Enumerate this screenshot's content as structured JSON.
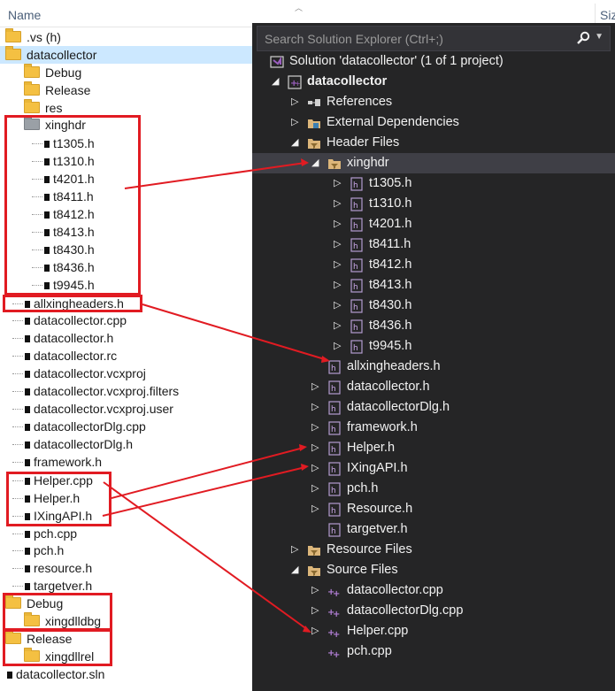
{
  "left_panel": {
    "header": {
      "name": "Name",
      "size": "Siz"
    },
    "rows": [
      {
        "label": ".vs (h)",
        "kind": "folder"
      },
      {
        "label": "datacollector",
        "kind": "folder"
      },
      {
        "label": "Debug",
        "kind": "folder"
      },
      {
        "label": "Release",
        "kind": "folder"
      },
      {
        "label": "res",
        "kind": "folder"
      },
      {
        "label": "xinghdr",
        "kind": "folder"
      },
      {
        "label": "t1305.h",
        "kind": "file"
      },
      {
        "label": "t1310.h",
        "kind": "file"
      },
      {
        "label": "t4201.h",
        "kind": "file"
      },
      {
        "label": "t8411.h",
        "kind": "file"
      },
      {
        "label": "t8412.h",
        "kind": "file"
      },
      {
        "label": "t8413.h",
        "kind": "file"
      },
      {
        "label": "t8430.h",
        "kind": "file"
      },
      {
        "label": "t8436.h",
        "kind": "file"
      },
      {
        "label": "t9945.h",
        "kind": "file"
      },
      {
        "label": "allxingheaders.h",
        "kind": "file"
      },
      {
        "label": "datacollector.cpp",
        "kind": "file"
      },
      {
        "label": "datacollector.h",
        "kind": "file"
      },
      {
        "label": "datacollector.rc",
        "kind": "file"
      },
      {
        "label": "datacollector.vcxproj",
        "kind": "file"
      },
      {
        "label": "datacollector.vcxproj.filters",
        "kind": "file"
      },
      {
        "label": "datacollector.vcxproj.user",
        "kind": "file"
      },
      {
        "label": "datacollectorDlg.cpp",
        "kind": "file"
      },
      {
        "label": "datacollectorDlg.h",
        "kind": "file"
      },
      {
        "label": "framework.h",
        "kind": "file"
      },
      {
        "label": "Helper.cpp",
        "kind": "file"
      },
      {
        "label": "Helper.h",
        "kind": "file"
      },
      {
        "label": "IXingAPI.h",
        "kind": "file"
      },
      {
        "label": "pch.cpp",
        "kind": "file"
      },
      {
        "label": "pch.h",
        "kind": "file"
      },
      {
        "label": "resource.h",
        "kind": "file"
      },
      {
        "label": "targetver.h",
        "kind": "file"
      },
      {
        "label": "Debug",
        "kind": "folder"
      },
      {
        "label": "xingdlldbg",
        "kind": "folder"
      },
      {
        "label": "Release",
        "kind": "folder"
      },
      {
        "label": "xingdllrel",
        "kind": "folder"
      },
      {
        "label": "datacollector.sln",
        "kind": "file"
      }
    ]
  },
  "solution_explorer": {
    "search_placeholder": "Search Solution Explorer (Ctrl+;)",
    "rows": [
      {
        "label": "Solution 'datacollector' (1 of 1 project)",
        "icon": "solution-icon",
        "bold": false
      },
      {
        "label": "datacollector",
        "icon": "project-icon",
        "bold": true
      },
      {
        "label": "References",
        "icon": "references-icon",
        "bold": false
      },
      {
        "label": "External Dependencies",
        "icon": "external-deps-icon",
        "bold": false
      },
      {
        "label": "Header Files",
        "icon": "filter-folder-icon",
        "bold": false
      },
      {
        "label": "xinghdr",
        "icon": "filter-folder-icon",
        "bold": false
      },
      {
        "label": "t1305.h",
        "icon": "header-file-icon",
        "bold": false
      },
      {
        "label": "t1310.h",
        "icon": "header-file-icon",
        "bold": false
      },
      {
        "label": "t4201.h",
        "icon": "header-file-icon",
        "bold": false
      },
      {
        "label": "t8411.h",
        "icon": "header-file-icon",
        "bold": false
      },
      {
        "label": "t8412.h",
        "icon": "header-file-icon",
        "bold": false
      },
      {
        "label": "t8413.h",
        "icon": "header-file-icon",
        "bold": false
      },
      {
        "label": "t8430.h",
        "icon": "header-file-icon",
        "bold": false
      },
      {
        "label": "t8436.h",
        "icon": "header-file-icon",
        "bold": false
      },
      {
        "label": "t9945.h",
        "icon": "header-file-icon",
        "bold": false
      },
      {
        "label": "allxingheaders.h",
        "icon": "header-file-icon",
        "bold": false
      },
      {
        "label": "datacollector.h",
        "icon": "header-file-icon",
        "bold": false
      },
      {
        "label": "datacollectorDlg.h",
        "icon": "header-file-icon",
        "bold": false
      },
      {
        "label": "framework.h",
        "icon": "header-file-icon",
        "bold": false
      },
      {
        "label": "Helper.h",
        "icon": "header-file-icon",
        "bold": false
      },
      {
        "label": "IXingAPI.h",
        "icon": "header-file-icon",
        "bold": false
      },
      {
        "label": "pch.h",
        "icon": "header-file-icon",
        "bold": false
      },
      {
        "label": "Resource.h",
        "icon": "header-file-icon",
        "bold": false
      },
      {
        "label": "targetver.h",
        "icon": "header-file-icon",
        "bold": false
      },
      {
        "label": "Resource Files",
        "icon": "filter-folder-icon",
        "bold": false
      },
      {
        "label": "Source Files",
        "icon": "filter-folder-icon",
        "bold": false
      },
      {
        "label": "datacollector.cpp",
        "icon": "cpp-file-icon",
        "bold": false
      },
      {
        "label": "datacollectorDlg.cpp",
        "icon": "cpp-file-icon",
        "bold": false
      },
      {
        "label": "Helper.cpp",
        "icon": "cpp-file-icon",
        "bold": false
      },
      {
        "label": "pch.cpp",
        "icon": "cpp-file-icon",
        "bold": false
      }
    ]
  },
  "colors": {
    "annotation_red": "#e11b22",
    "selection_blue": "#cce8ff",
    "dark_background": "#252526",
    "folder_yellow": "#f4c042",
    "vs_purple": "#9b5fc0"
  }
}
